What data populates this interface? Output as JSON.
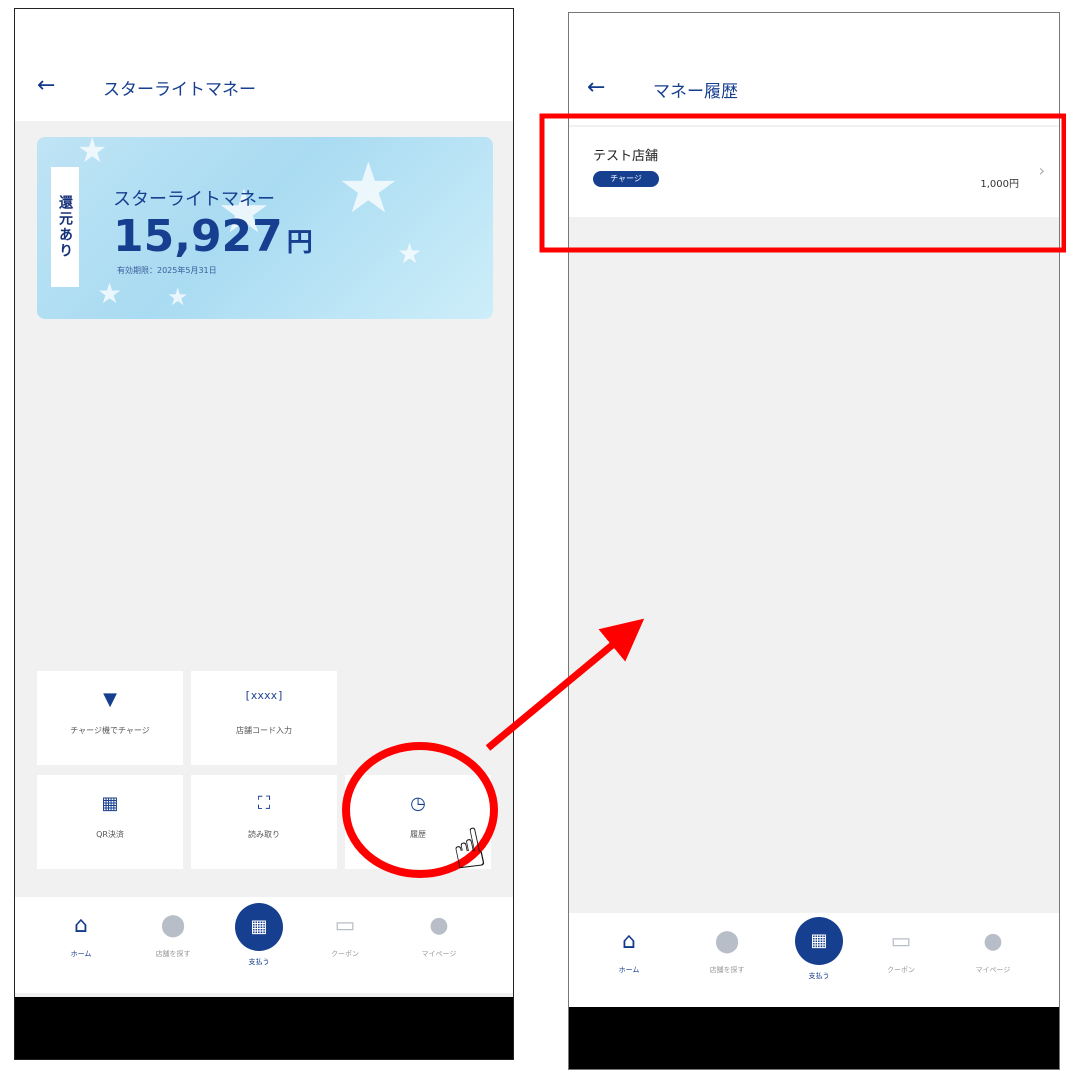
{
  "left_screen": {
    "title": "スターライトマネー",
    "back_icon": "back-arrow-icon",
    "card": {
      "tag": "還元あり",
      "name": "スターライトマネー",
      "amount": "15,927",
      "unit": "円",
      "expiry": "有効期限：2025年5月31日"
    },
    "actions": [
      {
        "label": "チャージ機でチャージ",
        "icon": "yen-charge-icon"
      },
      {
        "label": "店舗コード入力",
        "icon": "[xxxx]"
      },
      {
        "label": "QR決済",
        "icon": "qr-code-icon"
      },
      {
        "label": "読み取り",
        "icon": "scan-icon"
      },
      {
        "label": "履歴",
        "icon": "history-clock-icon"
      }
    ]
  },
  "right_screen": {
    "title": "マネー履歴",
    "back_icon": "back-arrow-icon",
    "history": [
      {
        "store": "テスト店舗",
        "type": "チャージ",
        "amount": "1,000円"
      }
    ]
  },
  "nav": [
    {
      "label": "ホーム",
      "icon": "home-icon"
    },
    {
      "label": "店舗を探す",
      "icon": "location-pin-icon"
    },
    {
      "label": "支払う",
      "icon": "qr-pay-icon"
    },
    {
      "label": "クーポン",
      "icon": "ticket-icon"
    },
    {
      "label": "マイページ",
      "icon": "person-icon"
    }
  ],
  "colors": {
    "brand": "#173f8f",
    "annotation": "#ff0000"
  }
}
